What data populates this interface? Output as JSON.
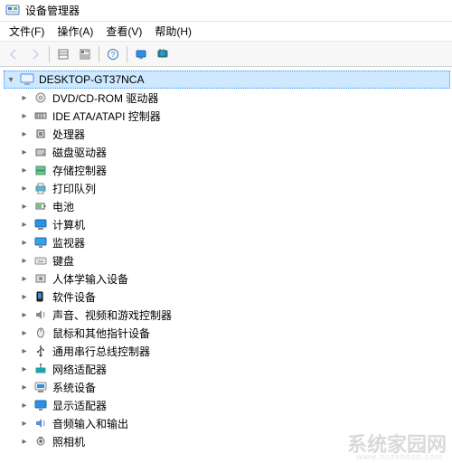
{
  "window": {
    "title": "设备管理器"
  },
  "menu": {
    "items": [
      {
        "label": "文件(F)"
      },
      {
        "label": "操作(A)"
      },
      {
        "label": "查看(V)"
      },
      {
        "label": "帮助(H)"
      }
    ]
  },
  "toolbar": {
    "buttons": [
      {
        "name": "back-icon",
        "disabled": true
      },
      {
        "name": "forward-icon",
        "disabled": true
      },
      {
        "name": "sep"
      },
      {
        "name": "view-list-icon",
        "disabled": false
      },
      {
        "name": "view-detail-icon",
        "disabled": false
      },
      {
        "name": "sep"
      },
      {
        "name": "help-icon",
        "disabled": false
      },
      {
        "name": "sep"
      },
      {
        "name": "monitor-icon",
        "disabled": false
      },
      {
        "name": "refresh-icon",
        "disabled": false
      }
    ]
  },
  "tree": {
    "root": {
      "label": "DESKTOP-GT37NCA",
      "expanded": true
    },
    "nodes": [
      {
        "label": "DVD/CD-ROM 驱动器",
        "icon": "disc-icon"
      },
      {
        "label": "IDE ATA/ATAPI 控制器",
        "icon": "ide-icon"
      },
      {
        "label": "处理器",
        "icon": "cpu-icon"
      },
      {
        "label": "磁盘驱动器",
        "icon": "disk-icon"
      },
      {
        "label": "存储控制器",
        "icon": "storage-icon"
      },
      {
        "label": "打印队列",
        "icon": "printer-icon"
      },
      {
        "label": "电池",
        "icon": "battery-icon"
      },
      {
        "label": "计算机",
        "icon": "computer-icon"
      },
      {
        "label": "监视器",
        "icon": "monitor-device-icon"
      },
      {
        "label": "键盘",
        "icon": "keyboard-icon"
      },
      {
        "label": "人体学输入设备",
        "icon": "hid-icon"
      },
      {
        "label": "软件设备",
        "icon": "software-icon"
      },
      {
        "label": "声音、视频和游戏控制器",
        "icon": "audio-icon"
      },
      {
        "label": "鼠标和其他指针设备",
        "icon": "mouse-icon"
      },
      {
        "label": "通用串行总线控制器",
        "icon": "usb-icon"
      },
      {
        "label": "网络适配器",
        "icon": "network-icon"
      },
      {
        "label": "系统设备",
        "icon": "system-icon"
      },
      {
        "label": "显示适配器",
        "icon": "display-icon"
      },
      {
        "label": "音频输入和输出",
        "icon": "audio-io-icon"
      },
      {
        "label": "照相机",
        "icon": "camera-icon"
      }
    ]
  },
  "watermark": {
    "main": "系统家园网",
    "sub": "www.hnzkhbsb.com"
  }
}
